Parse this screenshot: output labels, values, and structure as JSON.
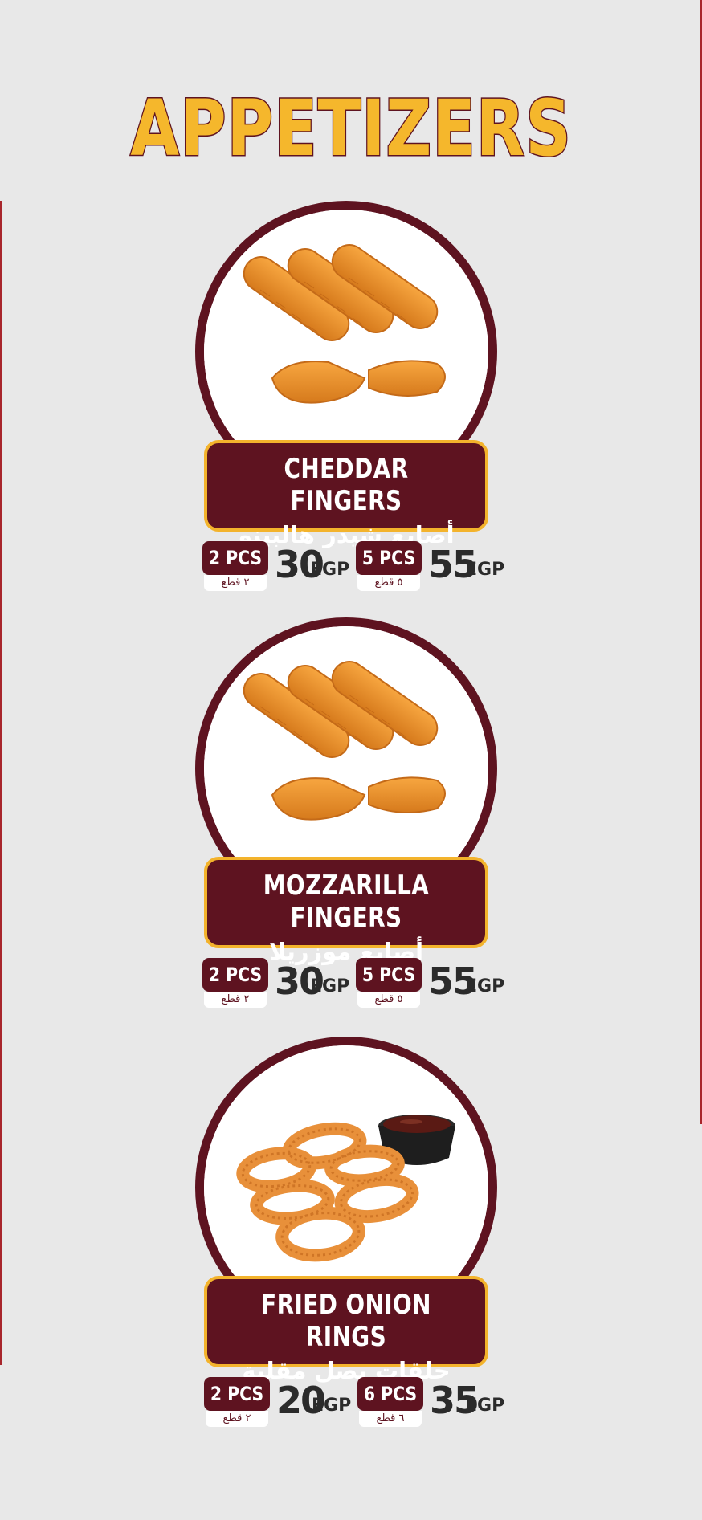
{
  "title": "APPETIZERS",
  "colors": {
    "background": "#e8e8e8",
    "maroon": "#5e1320",
    "gold": "#f5b72c",
    "text": "#2b2b2b"
  },
  "items": [
    {
      "name_en": "CHEDDAR FINGERS",
      "name_ar": "أصابع شيدر هالبينو",
      "image": "cheese-fingers-photo",
      "prices": [
        {
          "pcs": "2 PCS",
          "pcs_ar": "٢ قطع",
          "price": "30",
          "currency": "EGP"
        },
        {
          "pcs": "5 PCS",
          "pcs_ar": "٥ قطع",
          "price": "55",
          "currency": "EGP"
        }
      ]
    },
    {
      "name_en": "MOZZARILLA FINGERS",
      "name_ar": "أصابع موزريلا",
      "image": "cheese-fingers-photo",
      "prices": [
        {
          "pcs": "2 PCS",
          "pcs_ar": "٢ قطع",
          "price": "30",
          "currency": "EGP"
        },
        {
          "pcs": "5 PCS",
          "pcs_ar": "٥ قطع",
          "price": "55",
          "currency": "EGP"
        }
      ]
    },
    {
      "name_en": "FRIED ONION RINGS",
      "name_ar": "حلقات بصل مقلية",
      "image": "onion-rings-photo",
      "prices": [
        {
          "pcs": "2 PCS",
          "pcs_ar": "٢ قطع",
          "price": "20",
          "currency": "EGP"
        },
        {
          "pcs": "6 PCS",
          "pcs_ar": "٦ قطع",
          "price": "35",
          "currency": "EGP"
        }
      ]
    }
  ]
}
